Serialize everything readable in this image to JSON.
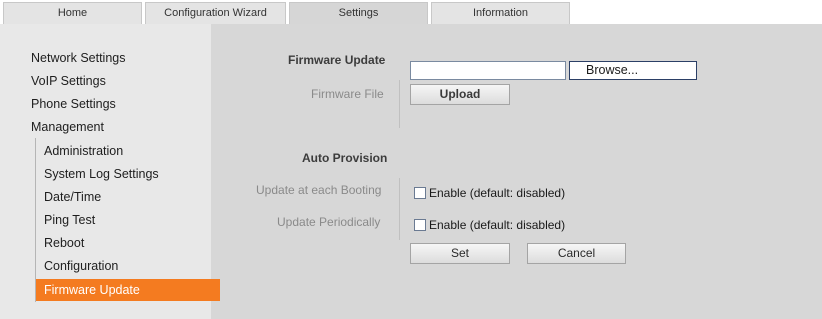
{
  "tabs": [
    {
      "label": "Home"
    },
    {
      "label": "Configuration Wizard"
    },
    {
      "label": "Settings"
    },
    {
      "label": "Information"
    }
  ],
  "sidebar": {
    "items": [
      {
        "label": "Network Settings"
      },
      {
        "label": "VoIP Settings"
      },
      {
        "label": "Phone Settings"
      },
      {
        "label": "Management"
      }
    ],
    "subitems": [
      {
        "label": "Administration"
      },
      {
        "label": "System Log Settings"
      },
      {
        "label": "Date/Time"
      },
      {
        "label": "Ping Test"
      },
      {
        "label": "Reboot"
      },
      {
        "label": "Configuration"
      },
      {
        "label": "Firmware Update"
      }
    ],
    "active_color": "#f47b20"
  },
  "firmware": {
    "title": "Firmware Update",
    "file_label": "Firmware File",
    "file_value": "",
    "browse_label": "Browse...",
    "upload_label": "Upload"
  },
  "auto_provision": {
    "title": "Auto Provision",
    "booting_label": "Update at each Booting",
    "booting_option": "Enable (default: disabled)",
    "booting_checked": false,
    "periodic_label": "Update Periodically",
    "periodic_option": "Enable (default: disabled)",
    "periodic_checked": false
  },
  "actions": {
    "set_label": "Set",
    "cancel_label": "Cancel"
  }
}
